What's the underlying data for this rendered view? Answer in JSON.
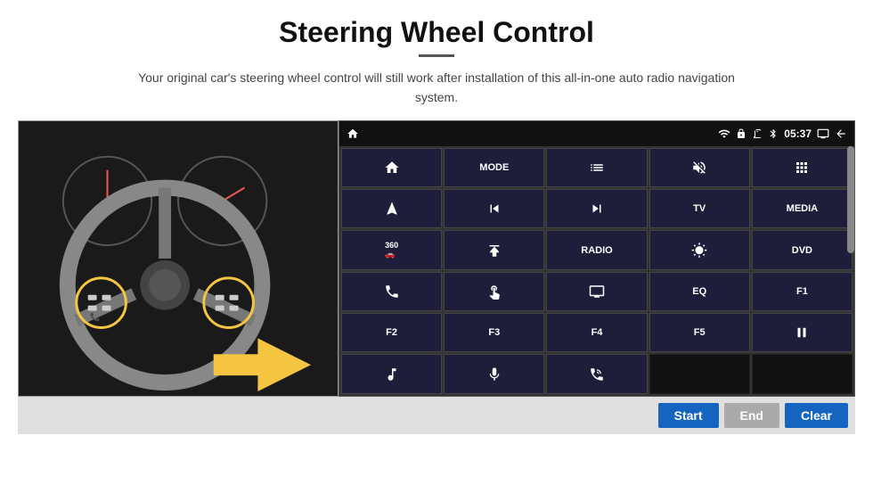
{
  "header": {
    "title": "Steering Wheel Control",
    "subtitle": "Your original car's steering wheel control will still work after installation of this all-in-one auto radio navigation system."
  },
  "statusBar": {
    "time": "05:37",
    "icons": [
      "wifi",
      "lock",
      "card",
      "bluetooth",
      "display",
      "back"
    ]
  },
  "gridButtons": [
    {
      "id": "home",
      "type": "icon",
      "icon": "home"
    },
    {
      "id": "mode",
      "type": "text",
      "label": "MODE"
    },
    {
      "id": "list",
      "type": "icon",
      "icon": "list"
    },
    {
      "id": "vol-mute",
      "type": "icon",
      "icon": "vol-mute"
    },
    {
      "id": "apps",
      "type": "icon",
      "icon": "apps"
    },
    {
      "id": "nav",
      "type": "icon",
      "icon": "nav"
    },
    {
      "id": "prev",
      "type": "icon",
      "icon": "prev"
    },
    {
      "id": "next",
      "type": "icon",
      "icon": "next"
    },
    {
      "id": "tv",
      "type": "text",
      "label": "TV"
    },
    {
      "id": "media",
      "type": "text",
      "label": "MEDIA"
    },
    {
      "id": "360cam",
      "type": "icon",
      "icon": "360cam"
    },
    {
      "id": "eject",
      "type": "icon",
      "icon": "eject"
    },
    {
      "id": "radio",
      "type": "text",
      "label": "RADIO"
    },
    {
      "id": "bright",
      "type": "icon",
      "icon": "bright"
    },
    {
      "id": "dvd",
      "type": "text",
      "label": "DVD"
    },
    {
      "id": "phone",
      "type": "icon",
      "icon": "phone"
    },
    {
      "id": "swipe",
      "type": "icon",
      "icon": "swipe"
    },
    {
      "id": "screen",
      "type": "icon",
      "icon": "screen"
    },
    {
      "id": "eq",
      "type": "text",
      "label": "EQ"
    },
    {
      "id": "f1",
      "type": "text",
      "label": "F1"
    },
    {
      "id": "f2",
      "type": "text",
      "label": "F2"
    },
    {
      "id": "f3",
      "type": "text",
      "label": "F3"
    },
    {
      "id": "f4",
      "type": "text",
      "label": "F4"
    },
    {
      "id": "f5",
      "type": "text",
      "label": "F5"
    },
    {
      "id": "playpause",
      "type": "icon",
      "icon": "playpause"
    },
    {
      "id": "music",
      "type": "icon",
      "icon": "music"
    },
    {
      "id": "mic",
      "type": "icon",
      "icon": "mic"
    },
    {
      "id": "volphone",
      "type": "icon",
      "icon": "volphone"
    },
    {
      "id": "empty1",
      "type": "empty"
    },
    {
      "id": "empty2",
      "type": "empty"
    }
  ],
  "bottomBar": {
    "startLabel": "Start",
    "endLabel": "End",
    "clearLabel": "Clear"
  }
}
